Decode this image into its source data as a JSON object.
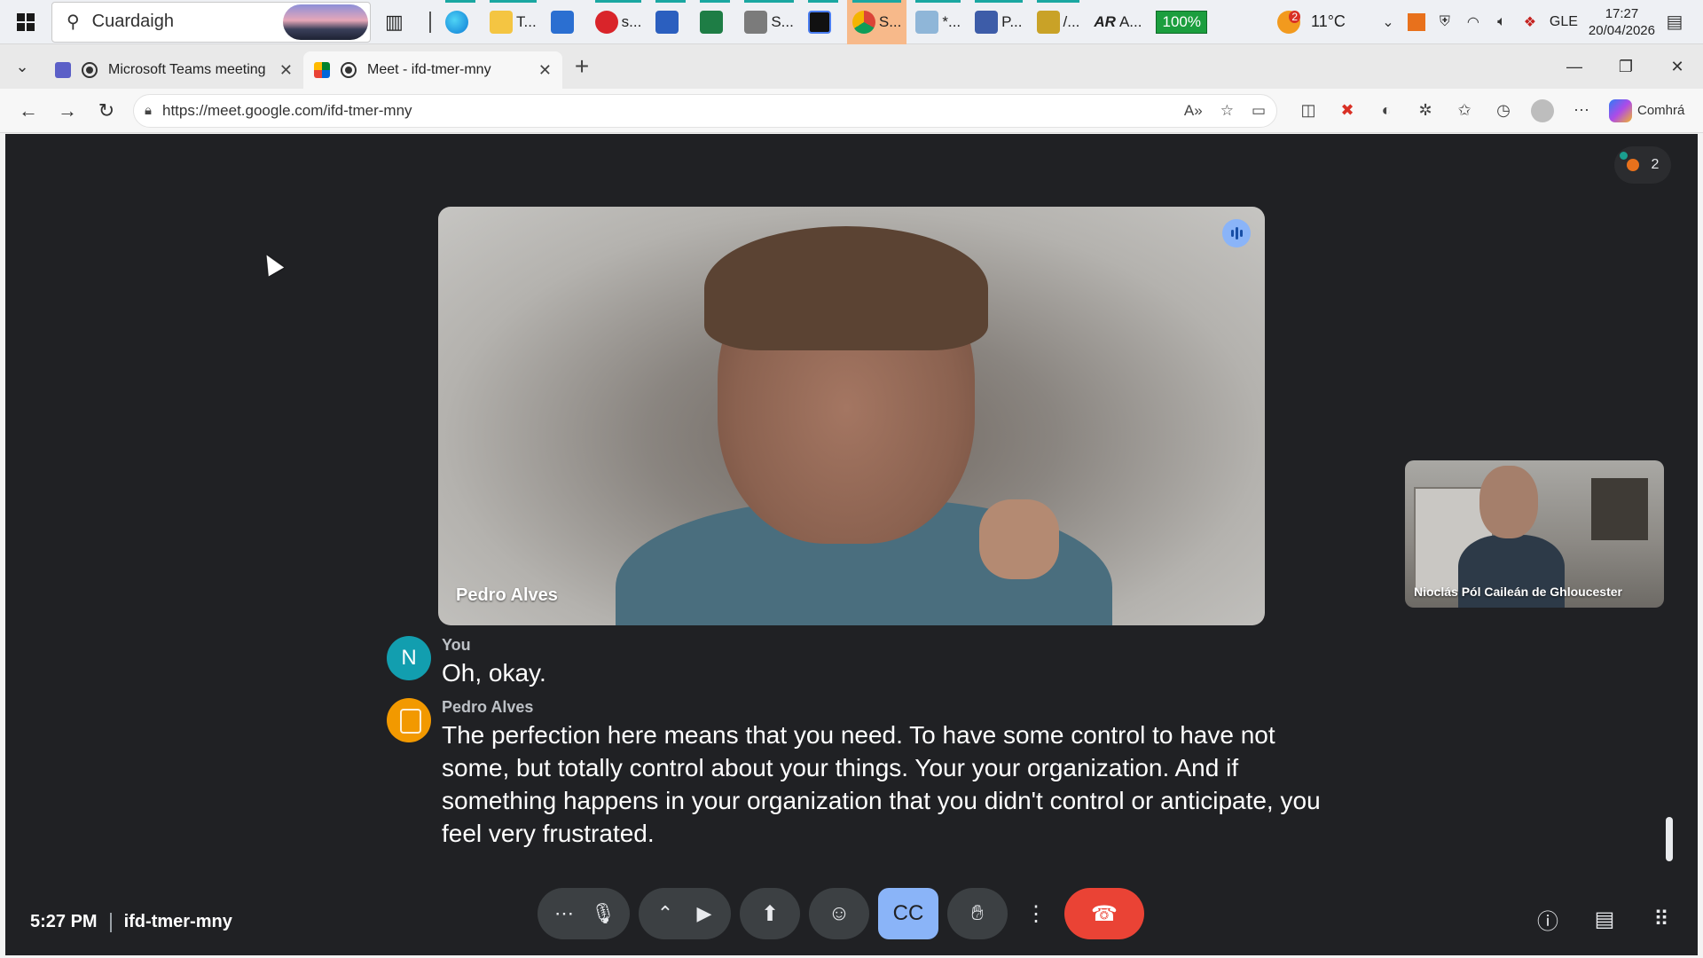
{
  "taskbar": {
    "search_placeholder": "Cuardaigh",
    "apps": [
      {
        "icon": "task-view-icon",
        "label": ""
      },
      {
        "icon": "edge-icon",
        "label": ""
      },
      {
        "icon": "file-explorer-icon",
        "label": "T..."
      },
      {
        "icon": "store-icon",
        "label": ""
      },
      {
        "icon": "app-s-icon",
        "label": "s..."
      },
      {
        "icon": "word-icon",
        "label": ""
      },
      {
        "icon": "excel-icon",
        "label": ""
      },
      {
        "icon": "app-s2-icon",
        "label": "S..."
      },
      {
        "icon": "app-w-icon",
        "label": ""
      },
      {
        "icon": "chrome-icon",
        "label": "S..."
      },
      {
        "icon": "app-star-icon",
        "label": "*..."
      },
      {
        "icon": "app-p-icon",
        "label": "P..."
      },
      {
        "icon": "app-m-icon",
        "label": "/..."
      },
      {
        "icon": "app-ar-icon",
        "label": "A..."
      }
    ],
    "battery_text": "100%",
    "weather_badge": "2",
    "temperature": "11°C",
    "language": "GLE",
    "time": "17:27",
    "date": "20/04/2026"
  },
  "browser": {
    "tabs": [
      {
        "title": "Microsoft Teams meeting | Mi",
        "active": false
      },
      {
        "title": "Meet - ifd-tmer-mny",
        "active": true
      }
    ],
    "url": "https://meet.google.com/ifd-tmer-mny",
    "copilot_label": "Comhrá"
  },
  "meet": {
    "participant_count": "2",
    "main_speaker": "Pedro Alves",
    "self_name": "Nioclás Pól Caileán de Ghloucester",
    "captions": [
      {
        "speaker": "You",
        "initial": "N",
        "text": "Oh, okay."
      },
      {
        "speaker": "Pedro Alves",
        "initial": "",
        "text": "The perfection here means that you need. To have some control to have not some, but totally control about your things. Your your organization. And if something happens in your organization that you didn't control or anticipate, you feel very frustrated."
      }
    ],
    "time": "5:27 PM",
    "meeting_code": "ifd-tmer-mny",
    "colors": {
      "background": "#202124",
      "end_call": "#ea4335",
      "captions_on": "#8ab4f8"
    }
  }
}
